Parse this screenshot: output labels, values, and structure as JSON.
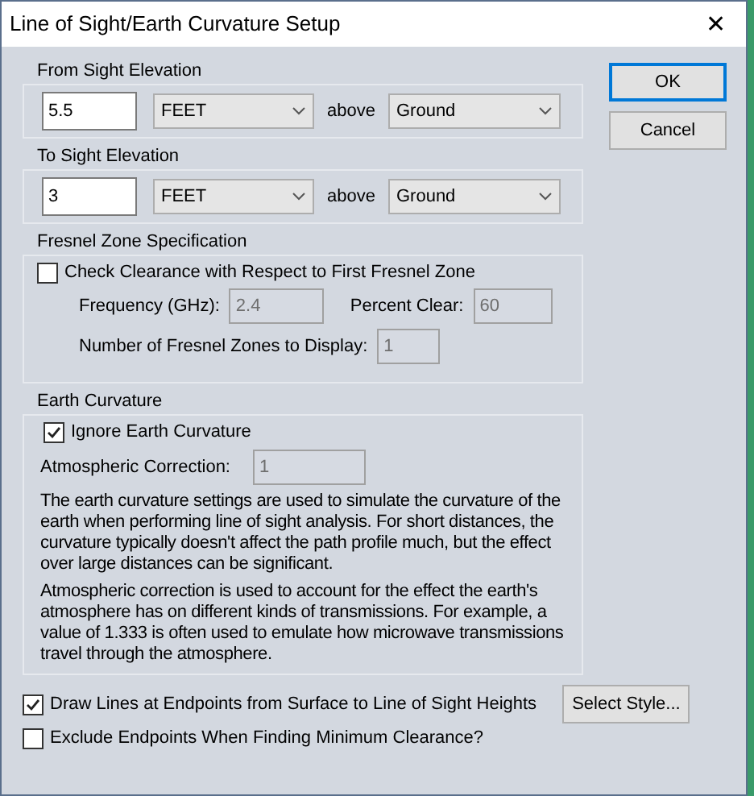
{
  "window": {
    "title": "Line of Sight/Earth Curvature Setup",
    "close": "✕"
  },
  "elevations": [
    {
      "title": "From Sight Elevation",
      "value": "5.5",
      "unit": "FEET",
      "above": "above",
      "reference": "Ground"
    },
    {
      "title": "To Sight Elevation",
      "value": "3",
      "unit": "FEET",
      "above": "above",
      "reference": "Ground"
    }
  ],
  "fresnel": {
    "title": "Fresnel Zone Specification",
    "check": {
      "label": "Check Clearance with Respect to First Fresnel Zone",
      "checked": false
    },
    "frequency": {
      "label": "Frequency (GHz):",
      "value": "2.4",
      "disabled": true
    },
    "percent": {
      "label": "Percent Clear:",
      "value": "60",
      "disabled": true
    },
    "zones": {
      "label": "Number of Fresnel Zones to Display:",
      "value": "1",
      "disabled": true
    }
  },
  "earth": {
    "title": "Earth Curvature",
    "check": {
      "label": "Ignore Earth Curvature",
      "checked": true
    },
    "correction": {
      "label": "Atmospheric Correction:",
      "value": "1",
      "disabled": true
    },
    "paragraphs": [
      "The earth curvature settings are used to simulate the curvature of the earth when performing line of sight analysis. For short distances, the curvature typically doesn't affect the path profile much, but the effect over large distances can be significant.",
      "Atmospheric correction is used to account for the effect the earth's atmosphere has on different kinds of transmissions. For example, a value of 1.333 is often used to emulate how microwave transmissions travel through the atmosphere."
    ]
  },
  "options": [
    {
      "label": "Draw Lines at Endpoints from Surface to Line of Sight Heights",
      "checked": true
    },
    {
      "label": "Exclude Endpoints When Finding Minimum Clearance?",
      "checked": false
    }
  ],
  "select_style": "Select Style...",
  "buttons": [
    {
      "label": "OK",
      "default": true
    },
    {
      "label": "Cancel",
      "default": false
    }
  ]
}
